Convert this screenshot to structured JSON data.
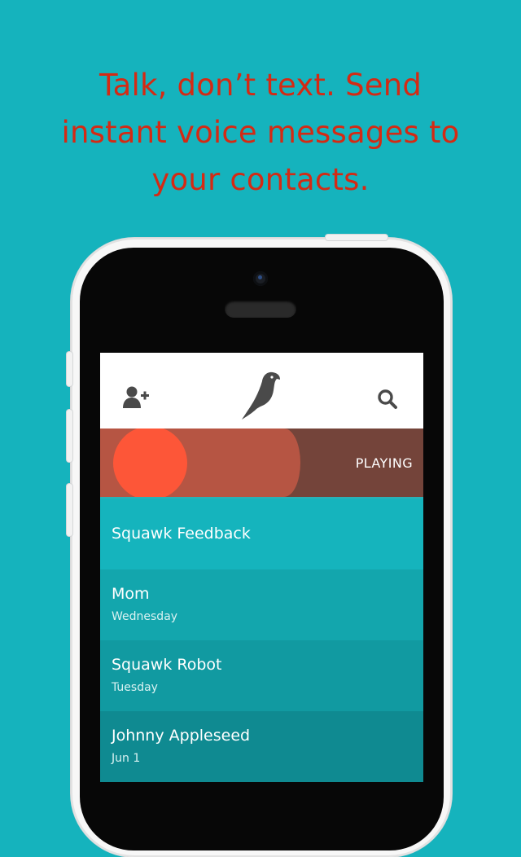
{
  "headline": {
    "line1": "Talk, don’t text. Send",
    "line2": "instant voice messages to",
    "line3": "your contacts."
  },
  "colors": {
    "background": "#15b3bd",
    "headline": "#d42a14",
    "player_dark": "#74443a",
    "player_progress": "#b65543",
    "player_dot": "#fd5638"
  },
  "navbar": {
    "left_icon": "add-contact-icon",
    "center_icon": "parrot-logo-icon",
    "right_icon": "search-icon"
  },
  "player": {
    "status": "PLAYING",
    "progress": 0.62
  },
  "conversations": [
    {
      "name": "Squawk Feedback",
      "subtitle": "",
      "color": "#15b4bd"
    },
    {
      "name": "Mom",
      "subtitle": "Wednesday",
      "color": "#13a6ad"
    },
    {
      "name": "Squawk Robot",
      "subtitle": "Tuesday",
      "color": "#119aa1"
    },
    {
      "name": "Johnny Appleseed",
      "subtitle": "Jun 1",
      "color": "#0f8a91"
    }
  ]
}
